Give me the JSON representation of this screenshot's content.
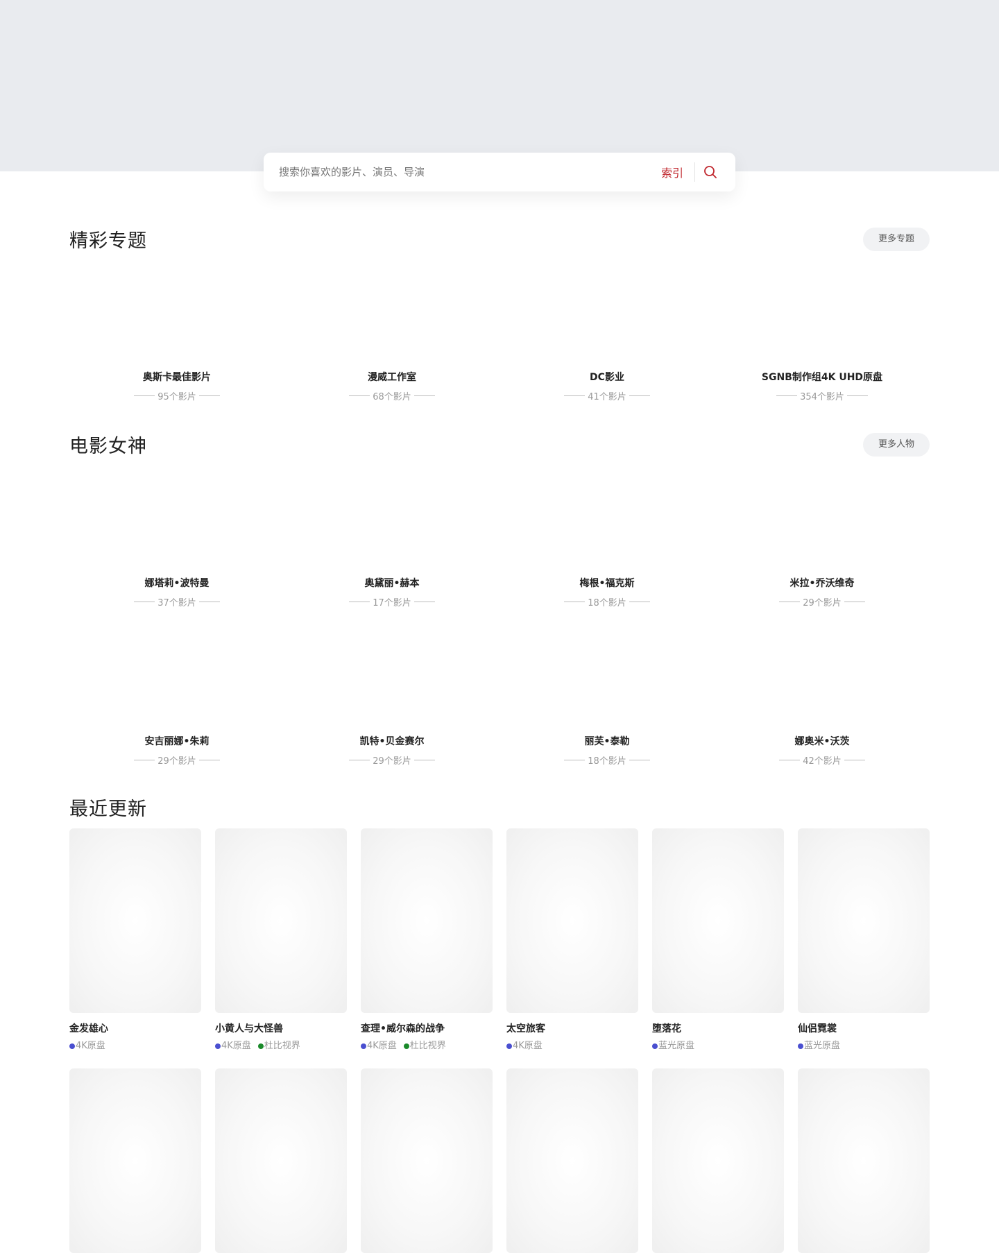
{
  "search": {
    "placeholder": "搜索你喜欢的影片、演员、导演",
    "index_label": "索引"
  },
  "topics": {
    "title": "精彩专题",
    "more_label": "更多专题",
    "items": [
      {
        "name": "奥斯卡最佳影片",
        "count": "95个影片"
      },
      {
        "name": "漫威工作室",
        "count": "68个影片"
      },
      {
        "name": "DC影业",
        "count": "41个影片"
      },
      {
        "name": "SGNB制作组4K UHD原盘",
        "count": "354个影片"
      }
    ]
  },
  "goddess": {
    "title": "电影女神",
    "more_label": "更多人物",
    "items": [
      {
        "name": "娜塔莉•波特曼",
        "count": "37个影片"
      },
      {
        "name": "奥黛丽•赫本",
        "count": "17个影片"
      },
      {
        "name": "梅根•福克斯",
        "count": "18个影片"
      },
      {
        "name": "米拉•乔沃维奇",
        "count": "29个影片"
      },
      {
        "name": "安吉丽娜•朱莉",
        "count": "29个影片"
      },
      {
        "name": "凯特•贝金赛尔",
        "count": "29个影片"
      },
      {
        "name": "丽芙•泰勒",
        "count": "18个影片"
      },
      {
        "name": "娜奥米•沃茨",
        "count": "42个影片"
      }
    ]
  },
  "recent": {
    "title": "最近更新",
    "items": [
      {
        "title": "金发雄心",
        "tags": [
          {
            "label": "4K原盘",
            "color": "#4a4fd0"
          }
        ]
      },
      {
        "title": "小黄人与大怪兽",
        "tags": [
          {
            "label": "4K原盘",
            "color": "#4a4fd0"
          },
          {
            "label": "杜比视界",
            "color": "#1a8a2a"
          }
        ]
      },
      {
        "title": "查理•威尔森的战争",
        "tags": [
          {
            "label": "4K原盘",
            "color": "#4a4fd0"
          },
          {
            "label": "杜比视界",
            "color": "#1a8a2a"
          }
        ]
      },
      {
        "title": "太空旅客",
        "tags": [
          {
            "label": "4K原盘",
            "color": "#4a4fd0"
          }
        ]
      },
      {
        "title": "堕落花",
        "tags": [
          {
            "label": "蓝光原盘",
            "color": "#4a4fd0"
          }
        ]
      },
      {
        "title": "仙侣霓裳",
        "tags": [
          {
            "label": "蓝光原盘",
            "color": "#4a4fd0"
          }
        ]
      }
    ]
  },
  "colors": {
    "accent": "#c0262d",
    "hero_bg": "#e9ebef"
  }
}
